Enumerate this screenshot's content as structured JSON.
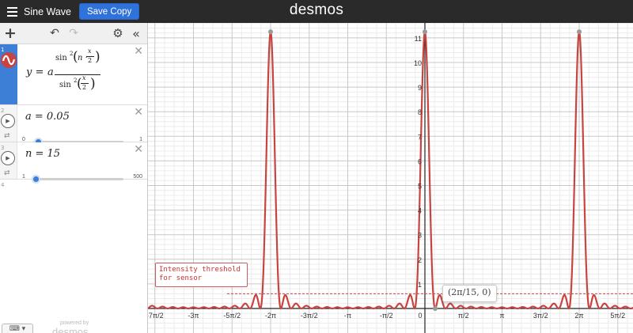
{
  "topbar": {
    "graph_title": "Sine Wave",
    "save_button": "Save Copy",
    "brand": "desmos"
  },
  "toolbar": {
    "add_icon": "plus-icon",
    "undo_icon": "undo-icon",
    "redo_icon": "redo-icon",
    "settings_icon": "gear-icon",
    "collapse_icon": "double-chevron-left-icon"
  },
  "expressions": [
    {
      "index": "1",
      "latex": "y = a · sin²(n · x/2) / sin²(x/2)",
      "lhs": "y =",
      "coef": "a",
      "num_fn": "sin",
      "num_exp": "2",
      "num_arg_n": "n ·",
      "num_arg_x": "x",
      "num_arg_2": "2",
      "den_fn": "sin",
      "den_exp": "2",
      "den_arg_x": "x",
      "den_arg_2": "2",
      "color": "#c74440"
    },
    {
      "index": "2",
      "text": "a = 0.05",
      "slider_min": "0",
      "slider_max": "1",
      "value": 0.05,
      "slider_fraction": 0.05
    },
    {
      "index": "3",
      "text": "n = 15",
      "slider_min": "1",
      "slider_max": "500",
      "value": 15,
      "slider_fraction": 0.028
    },
    {
      "index": "4"
    }
  ],
  "footer": {
    "keyboard_icon": "keyboard-icon",
    "powered_by": "powered by",
    "powered_logo": "desmos"
  },
  "graph": {
    "x_tick_labels": [
      "-7π/2",
      "-3π",
      "-5π/2",
      "-2π",
      "-3π/2",
      "-π",
      "-π/2",
      "0",
      "π/2",
      "π",
      "3π/2",
      "2π",
      "5π/2"
    ],
    "y_tick_labels": [
      "11",
      "10",
      "9",
      "8",
      "7",
      "6",
      "5",
      "4",
      "3",
      "2",
      "1"
    ],
    "curve_color": "#c74440",
    "threshold_label": "Intensity threshold for sensor",
    "threshold_value": 0.6,
    "point_label": "(2π/15, 0)",
    "peak_value": 11.25
  }
}
